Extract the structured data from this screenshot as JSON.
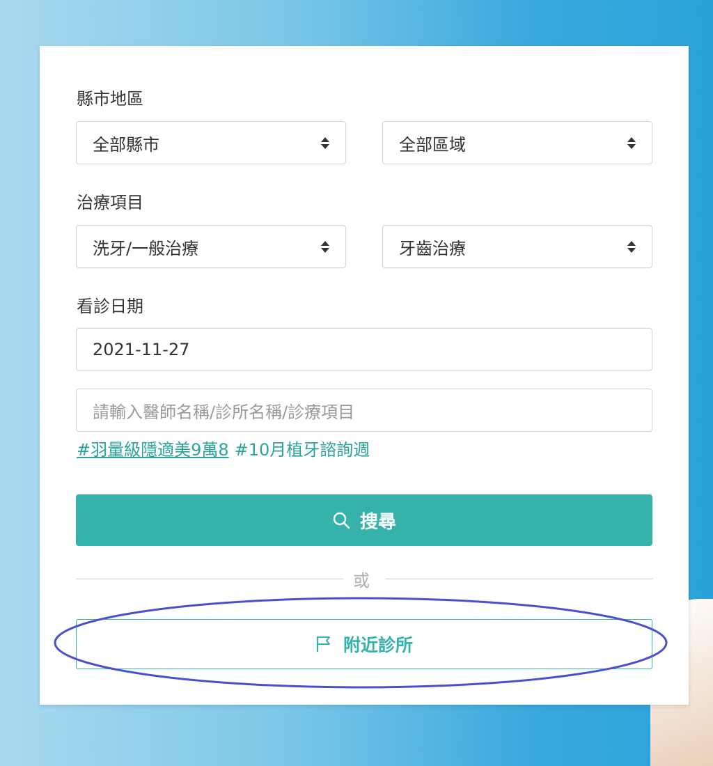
{
  "form": {
    "region_label": "縣市地區",
    "city_select": "全部縣市",
    "district_select": "全部區域",
    "treatment_label": "治療項目",
    "treatment_select": "洗牙/一般治療",
    "treatment_sub_select": "牙齒治療",
    "date_label": "看診日期",
    "date_value": "2021-11-27",
    "search_placeholder": "請輸入醫師名稱/診所名稱/診療項目"
  },
  "tags": [
    "#羽量級隱適美9萬8",
    "#10月植牙諮詢週"
  ],
  "buttons": {
    "search_label": "搜尋",
    "divider_text": "或",
    "nearby_label": "附近診所"
  },
  "colors": {
    "accent": "#35b3aa",
    "highlight_ellipse": "#4a4fd0"
  },
  "icons": {
    "search": "search-icon",
    "nearby": "flag-icon",
    "select": "sort-caret-icon"
  }
}
